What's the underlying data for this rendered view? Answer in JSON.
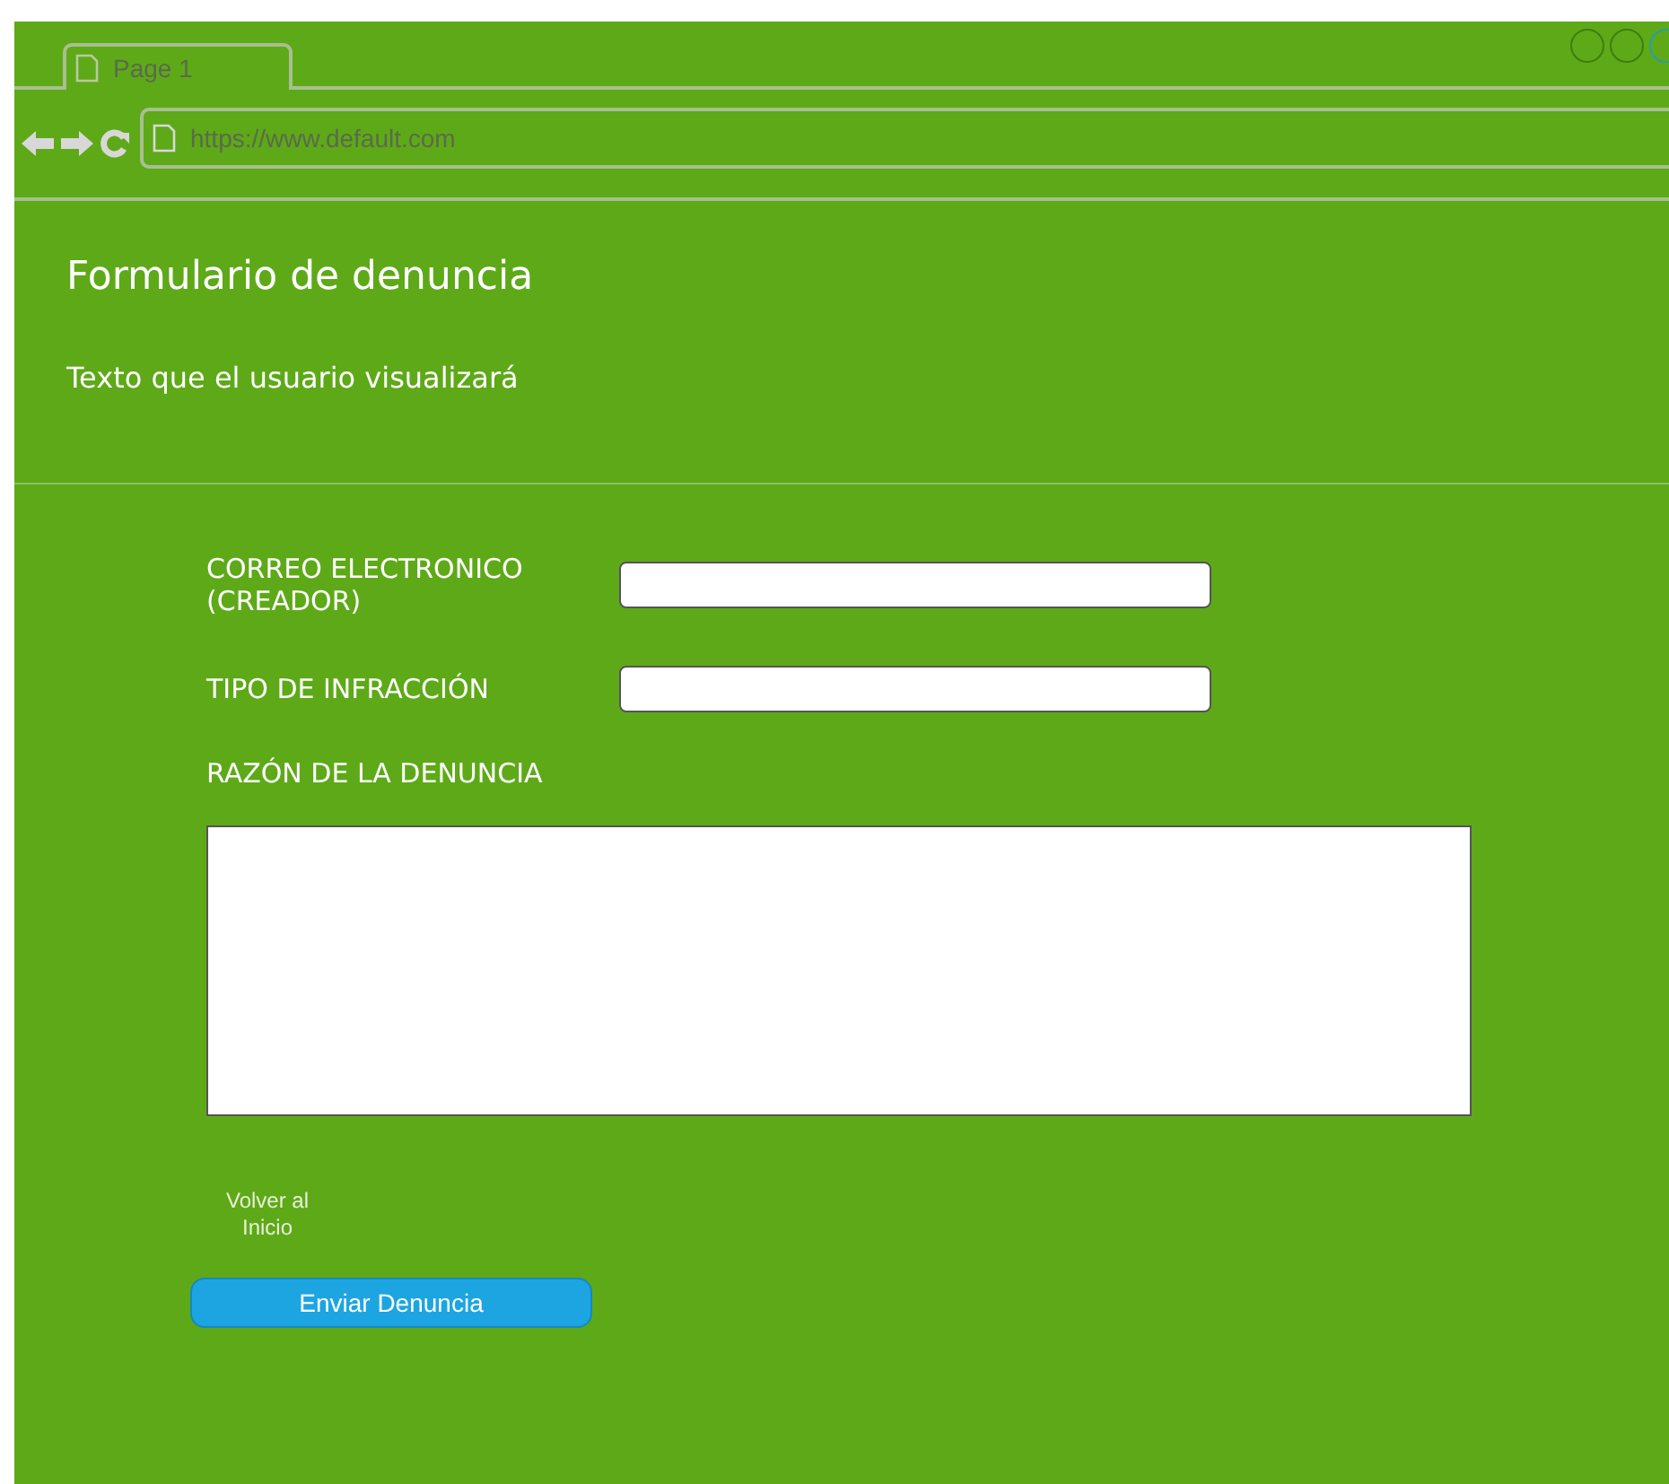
{
  "browser": {
    "tab": {
      "label": "Page 1"
    },
    "address": "https://www.default.com"
  },
  "header": {
    "title": "Formulario de denuncia",
    "subtitle": "Texto que el usuario visualizará"
  },
  "form": {
    "fields": [
      {
        "label": "CORREO ELECTRONICO (CREADOR)",
        "kind": "input"
      },
      {
        "label": "TIPO DE INFRACCIÓN",
        "kind": "input"
      },
      {
        "label": "RAZÓN DE LA DENUNCIA",
        "kind": "textarea"
      }
    ],
    "back_link": "Volver al Inicio",
    "submit": "Enviar Denuncia"
  }
}
